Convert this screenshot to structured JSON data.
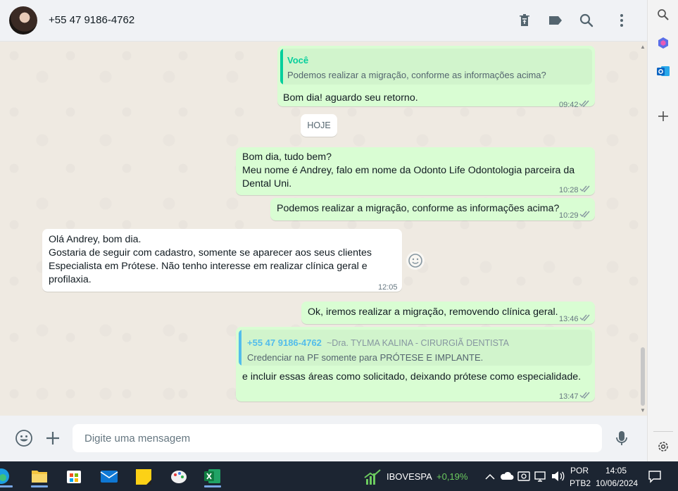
{
  "header": {
    "contact_name": "+55 47 9186-4762",
    "icons": [
      "delete-icon",
      "label-icon",
      "search-icon",
      "menu-icon"
    ]
  },
  "messages": {
    "m1": {
      "quote_author": "Você",
      "quote_text": "Podemos realizar a migração, conforme as informações acima?",
      "text": "Bom dia! aguardo seu retorno.",
      "time": "09:42"
    },
    "date_chip": "HOJE",
    "m2": {
      "text": "Bom dia, tudo bem?\nMeu nome é Andrey, falo em nome da Odonto Life Odontologia parceira da\nDental Uni.",
      "time": "10:28"
    },
    "m3": {
      "text": "Podemos realizar a migração, conforme as informações acima?",
      "time": "10:29"
    },
    "m4": {
      "text": "Olá Andrey, bom dia.\nGostaria de seguir com cadastro, somente se aparecer aos seus clientes\nEspecialista em Prótese. Não tenho interesse em realizar clínica geral e\nprofilaxia.",
      "time": "12:05"
    },
    "m5": {
      "text": "Ok, iremos realizar a migração, removendo clínica geral.",
      "time": "13:46"
    },
    "m6": {
      "quote_author": "+55 47 9186-4762",
      "quote_sub": "~Dra. TYLMA KALINA - CIRURGIÃ DENTISTA",
      "quote_text": "Credenciar na PF somente para PRÓTESE E IMPLANTE.",
      "text": "e incluir essas áreas como solicitado, deixando prótese como especialidade.",
      "time": "13:47"
    }
  },
  "compose": {
    "placeholder": "Digite uma mensagem"
  },
  "taskbar": {
    "ticker_name": "IBOVESPA",
    "ticker_change": "+0,19%",
    "lang_top": "POR",
    "lang_bottom": "PTB2",
    "time": "14:05",
    "date": "10/06/2024"
  },
  "colors": {
    "outgoing_bubble": "#d9fdd3",
    "incoming_bubble": "#ffffff",
    "quote_you": "#06cf9c",
    "quote_other": "#53bdeb",
    "ticker_up": "#6ccb5f"
  }
}
